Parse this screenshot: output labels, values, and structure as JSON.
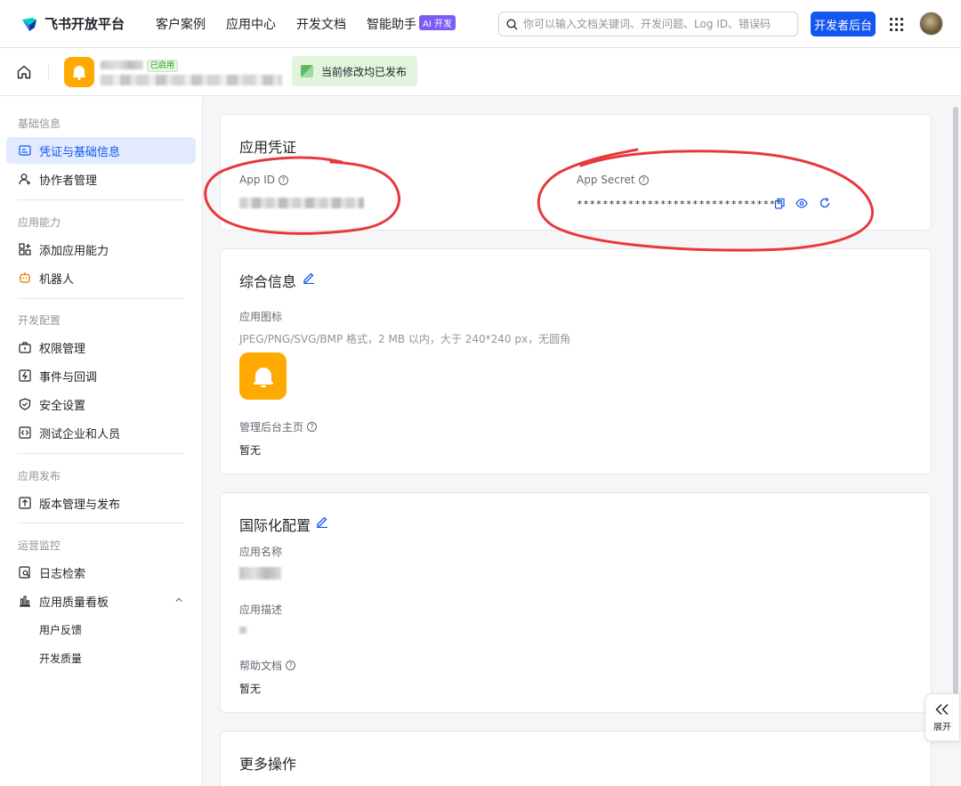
{
  "topbar": {
    "brand": "飞书开放平台",
    "nav": [
      "客户案例",
      "应用中心",
      "开发文档",
      "智能助手"
    ],
    "ai_badge": "AI 开发",
    "search_placeholder": "你可以输入文档关键词、开发问题、Log ID、错误码",
    "console_button": "开发者后台",
    "brand_color": "#1456f0"
  },
  "subbar": {
    "app_status_tag": "已启用",
    "publish_status": "当前修改均已发布"
  },
  "sidebar": {
    "groups": [
      {
        "title": "基础信息",
        "items": [
          "凭证与基础信息",
          "协作者管理"
        ]
      },
      {
        "title": "应用能力",
        "items": [
          "添加应用能力",
          "机器人"
        ]
      },
      {
        "title": "开发配置",
        "items": [
          "权限管理",
          "事件与回调",
          "安全设置",
          "测试企业和人员"
        ]
      },
      {
        "title": "应用发布",
        "items": [
          "版本管理与发布"
        ]
      },
      {
        "title": "运营监控",
        "items": [
          "日志检索",
          "应用质量看板"
        ]
      }
    ],
    "sub_items": [
      "用户反馈",
      "开发质量"
    ],
    "active_item": "凭证与基础信息"
  },
  "credentials": {
    "title": "应用凭证",
    "app_id_label": "App ID",
    "app_secret_label": "App Secret",
    "app_secret_masked": "********************************"
  },
  "general": {
    "title": "综合信息",
    "icon_label": "应用图标",
    "icon_hint": "JPEG/PNG/SVG/BMP 格式，2 MB 以内，大于 240*240 px，无圆角",
    "homepage_label": "管理后台主页",
    "homepage_value": "暂无"
  },
  "i18n": {
    "title": "国际化配置",
    "name_label": "应用名称",
    "desc_label": "应用描述",
    "help_doc_label": "帮助文档",
    "help_doc_value": "暂无"
  },
  "more": {
    "title": "更多操作"
  },
  "expand_label": "展开",
  "annotation_color": "#e8383d",
  "icons": [
    "home-icon",
    "copy-icon",
    "eye-icon",
    "refresh-icon",
    "edit-icon",
    "help-icon",
    "bell-icon"
  ]
}
